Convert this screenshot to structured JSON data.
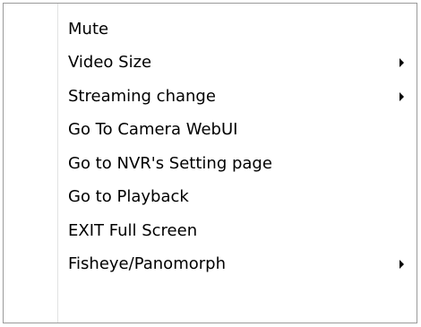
{
  "context_menu": {
    "items": [
      {
        "label": "Mute",
        "has_submenu": false
      },
      {
        "label": "Video Size",
        "has_submenu": true
      },
      {
        "label": "Streaming change",
        "has_submenu": true
      },
      {
        "label": "Go To Camera WebUI",
        "has_submenu": false
      },
      {
        "label": "Go to NVR's Setting page",
        "has_submenu": false
      },
      {
        "label": "Go to Playback",
        "has_submenu": false
      },
      {
        "label": "EXIT Full Screen",
        "has_submenu": false
      },
      {
        "label": "Fisheye/Panomorph",
        "has_submenu": true
      }
    ],
    "submenu_icon": "triangle-right-icon"
  }
}
